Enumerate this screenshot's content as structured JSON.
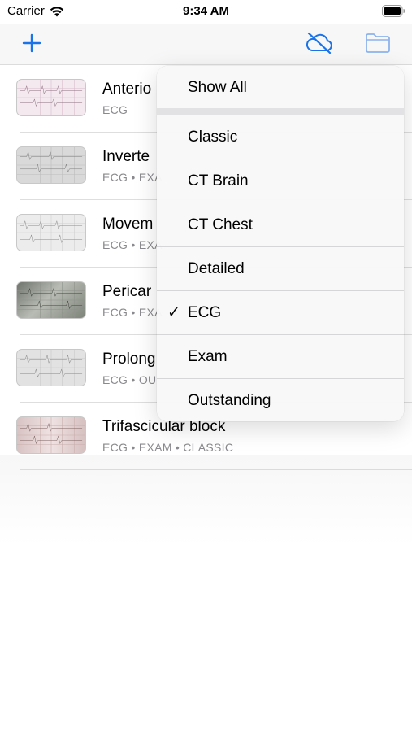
{
  "status": {
    "carrier": "Carrier",
    "time": "9:34 AM"
  },
  "nav": {
    "add_icon": "plus-icon",
    "sync_icon": "cloud-slash-icon",
    "folder_icon": "folder-icon",
    "accent": "#1a73e8"
  },
  "list": [
    {
      "title": "Anterio",
      "subtitle": "ECG",
      "thumb_color": "#f3e9ee"
    },
    {
      "title": "Inverte",
      "subtitle": "ECG • EXA",
      "thumb_color": "#d9d9d9"
    },
    {
      "title": "Movem",
      "subtitle": "ECG • EXA",
      "thumb_color": "#ececec"
    },
    {
      "title": "Pericar",
      "subtitle": "ECG • EXA",
      "thumb_color": "#9aa096"
    },
    {
      "title": "Prolong",
      "subtitle": "ECG • OU",
      "thumb_color": "#e2e2e2"
    },
    {
      "title": "Trifascicular block",
      "subtitle": "ECG • EXAM • CLASSIC",
      "thumb_color": "#e3d3d3"
    }
  ],
  "menu": {
    "show_all": "Show All",
    "items": [
      {
        "label": "Classic",
        "checked": false
      },
      {
        "label": "CT Brain",
        "checked": false
      },
      {
        "label": "CT Chest",
        "checked": false
      },
      {
        "label": "Detailed",
        "checked": false
      },
      {
        "label": "ECG",
        "checked": true,
        "check": "✓"
      },
      {
        "label": "Exam",
        "checked": false
      },
      {
        "label": "Outstanding",
        "checked": false
      }
    ]
  }
}
